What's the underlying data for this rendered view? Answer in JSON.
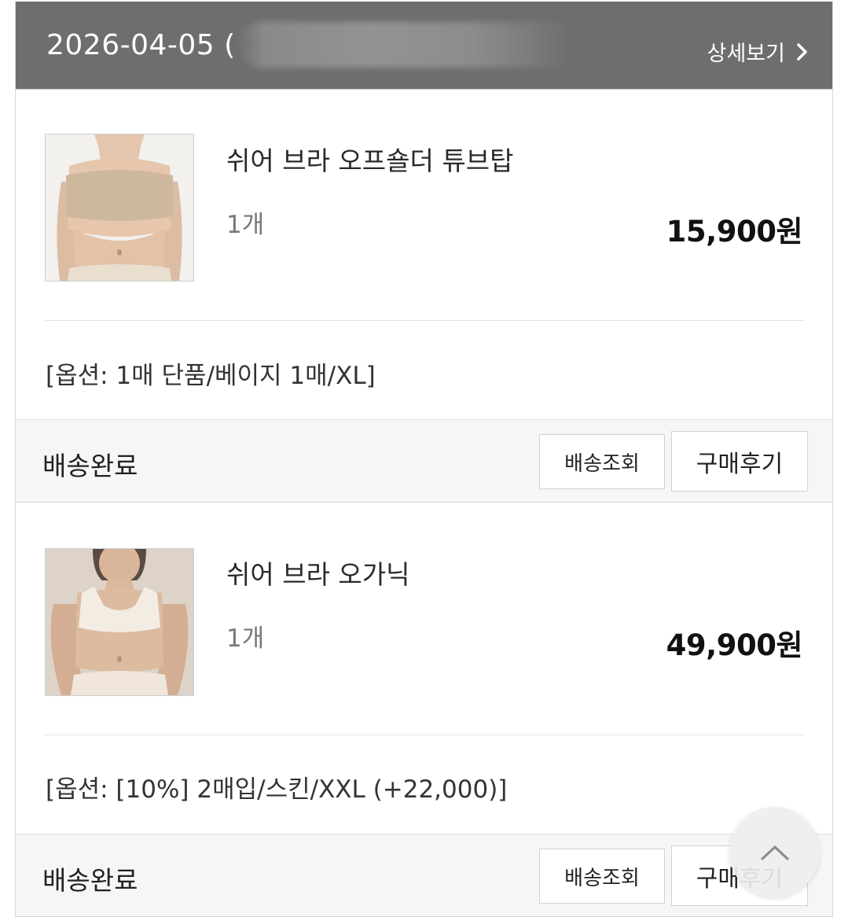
{
  "order": {
    "date": "2026-04-05 (",
    "detail_label": "상세보기"
  },
  "items": [
    {
      "name": "쉬어 브라 오프숄더 튜브탑",
      "qty": "1개",
      "price": "15,900원",
      "option": "[옵션: 1매 단품/베이지 1매/XL]",
      "status": "배송완료",
      "track_label": "배송조회",
      "review_label": "구매후기",
      "image": "product-photo-beige-tube-top"
    },
    {
      "name": "쉬어 브라 오가닉",
      "qty": "1개",
      "price": "49,900원",
      "option": "[옵션: [10%] 2매입/스킨/XXL (+22,000)]",
      "status": "배송완료",
      "track_label": "배송조회",
      "review_label": "구매후기",
      "image": "product-photo-ivory-bralette"
    }
  ],
  "icons": {
    "detail": "chevron-right-icon",
    "scroll_top": "chevron-up-icon"
  },
  "colors": {
    "header_bg": "#6e6e6e",
    "status_bar_bg": "#f6f6f6"
  }
}
